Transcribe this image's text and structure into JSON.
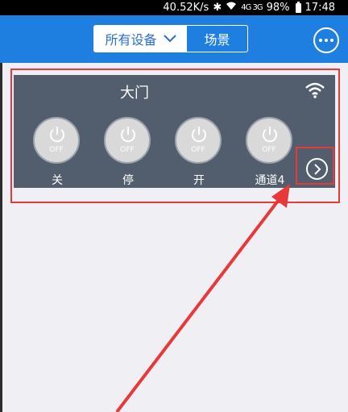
{
  "status_bar": {
    "speed": "40.52K/s",
    "signal": "4G 3G",
    "battery": "98%",
    "time": "17:48"
  },
  "header": {
    "segment_active": "所有设备",
    "segment_inactive": "场景"
  },
  "device_card": {
    "title": "大门",
    "channels": [
      {
        "state": "OFF",
        "label": "关"
      },
      {
        "state": "OFF",
        "label": "停"
      },
      {
        "state": "OFF",
        "label": "开"
      },
      {
        "state": "OFF",
        "label": "通道4"
      }
    ]
  },
  "colors": {
    "header_bg": "#1f7fe0",
    "card_bg": "#525e6e",
    "annotation": "#e8393a"
  },
  "icons": [
    "bluetooth-icon",
    "wifi-icon",
    "power-icon",
    "more-icon",
    "chevron-right-icon",
    "chevron-down-icon"
  ]
}
